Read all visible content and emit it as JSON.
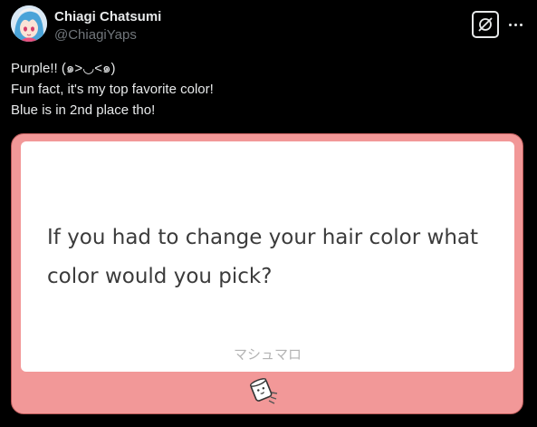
{
  "author": {
    "display_name": "Chiagi Chatsumi",
    "handle": "@ChiagiYaps"
  },
  "header_icons": {
    "grok": "grok-icon",
    "more": "more-icon"
  },
  "tweet": {
    "lines": [
      "Purple!! (๑>◡<๑)",
      "Fun fact, it's my top favorite color!",
      "Blue is in 2nd place tho!"
    ]
  },
  "card": {
    "question": "If you had to change your hair color what color would you pick?",
    "brand": "マシュマロ",
    "icon": "marshmallow-icon",
    "background_color": "#f29898"
  }
}
